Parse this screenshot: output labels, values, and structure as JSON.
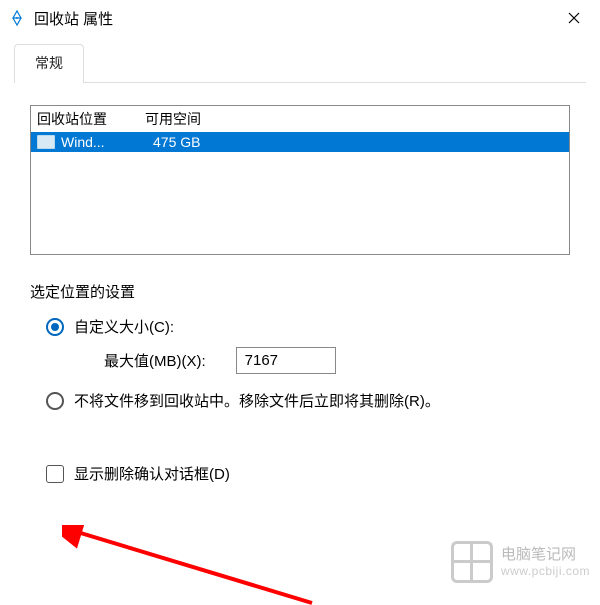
{
  "titlebar": {
    "title": "回收站 属性"
  },
  "tabs": {
    "general": "常规"
  },
  "list": {
    "header_location": "回收站位置",
    "header_space": "可用空间",
    "rows": [
      {
        "name": "Wind...",
        "space": "475 GB"
      }
    ]
  },
  "group": {
    "label": "选定位置的设置",
    "custom_size_label": "自定义大小(C):",
    "max_label": "最大值(MB)(X):",
    "max_value": "7167",
    "no_recycle_label": "不将文件移到回收站中。移除文件后立即将其删除(R)。"
  },
  "confirm": {
    "label": "显示删除确认对话框(D)"
  },
  "watermark": {
    "name": "电脑笔记网",
    "url": "www.pcbiji.com"
  }
}
